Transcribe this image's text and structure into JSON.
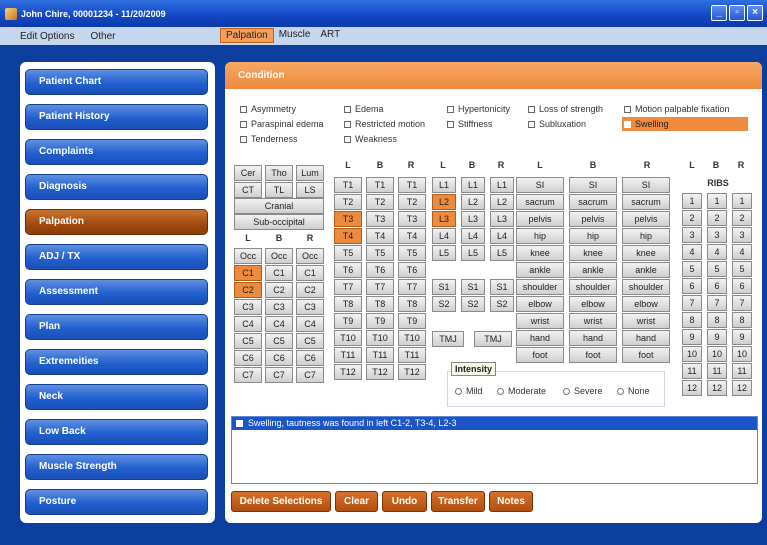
{
  "window": {
    "title": "John Chire, 00001234 - 11/20/2009"
  },
  "menu": {
    "items": [
      "Edit Options",
      "Other"
    ]
  },
  "tabs": [
    "Palpation",
    "Muscle",
    "ART"
  ],
  "sidebar": {
    "items": [
      {
        "label": "Patient Chart"
      },
      {
        "label": "Patient History"
      },
      {
        "label": "Complaints"
      },
      {
        "label": "Diagnosis"
      },
      {
        "label": "Palpation"
      },
      {
        "label": "ADJ / TX"
      },
      {
        "label": "Assessment"
      },
      {
        "label": "Plan"
      },
      {
        "label": "Extremeities"
      },
      {
        "label": "Neck"
      },
      {
        "label": "Low Back"
      },
      {
        "label": "Muscle Strength"
      },
      {
        "label": "Posture"
      }
    ],
    "active": "Palpation"
  },
  "main": {
    "header": "Condition",
    "conditions": [
      {
        "label": "Asymmetry",
        "checked": false
      },
      {
        "label": "Edema",
        "checked": false
      },
      {
        "label": "Hypertonicity",
        "checked": false
      },
      {
        "label": "Loss of strength",
        "checked": false
      },
      {
        "label": "Motion palpable fixation",
        "checked": false
      },
      {
        "label": "Paraspinal edema",
        "checked": false
      },
      {
        "label": "Restricted motion",
        "checked": false
      },
      {
        "label": "Stiffness",
        "checked": false
      },
      {
        "label": "Subluxation",
        "checked": false
      },
      {
        "label": "Swelling",
        "checked": true
      },
      {
        "label": "Tenderness",
        "checked": false
      },
      {
        "label": "Weakness",
        "checked": false
      }
    ]
  },
  "grid": {
    "region_buttons": [
      "Cer",
      "Tho",
      "Lum",
      "CT",
      "TL",
      "LS"
    ],
    "cranial": "Cranial",
    "suboccipital": "Sub-occipital",
    "lbr": [
      "L",
      "B",
      "R"
    ],
    "occ": "Occ",
    "cervical": [
      "C1",
      "C2",
      "C3",
      "C4",
      "C5",
      "C6",
      "C7"
    ],
    "thoracic": [
      "T1",
      "T2",
      "T3",
      "T4",
      "T5",
      "T6",
      "T7",
      "T8",
      "T9",
      "T10",
      "T11",
      "T12"
    ],
    "lumbar": [
      "L1",
      "L2",
      "L3",
      "L4",
      "L5"
    ],
    "sacral": [
      "S1",
      "S2"
    ],
    "tmj": "TMJ",
    "extremities": [
      "SI",
      "sacrum",
      "pelvis",
      "hip",
      "knee",
      "ankle",
      "shoulder",
      "elbow",
      "wrist",
      "hand",
      "foot"
    ],
    "ribs_label": "RIBS",
    "ribs": [
      "1",
      "2",
      "3",
      "4",
      "5",
      "6",
      "7",
      "8",
      "9",
      "10",
      "11",
      "12"
    ]
  },
  "selected": [
    "C1-L",
    "C2-L",
    "T3-L",
    "T4-L",
    "L2-L",
    "L3-L"
  ],
  "intensity": {
    "title": "Intensity",
    "options": [
      "Mild",
      "Moderate",
      "Severe",
      "None"
    ]
  },
  "summary": {
    "text": "Swelling, tautness was found in left C1-2, T3-4, L2-3"
  },
  "actions": [
    "Delete Selections",
    "Clear",
    "Undo",
    "Transfer",
    "Notes"
  ],
  "colors": {
    "accent": "#ee8a3e",
    "nav": "#2160cf",
    "nav_active": "#a44c12"
  }
}
